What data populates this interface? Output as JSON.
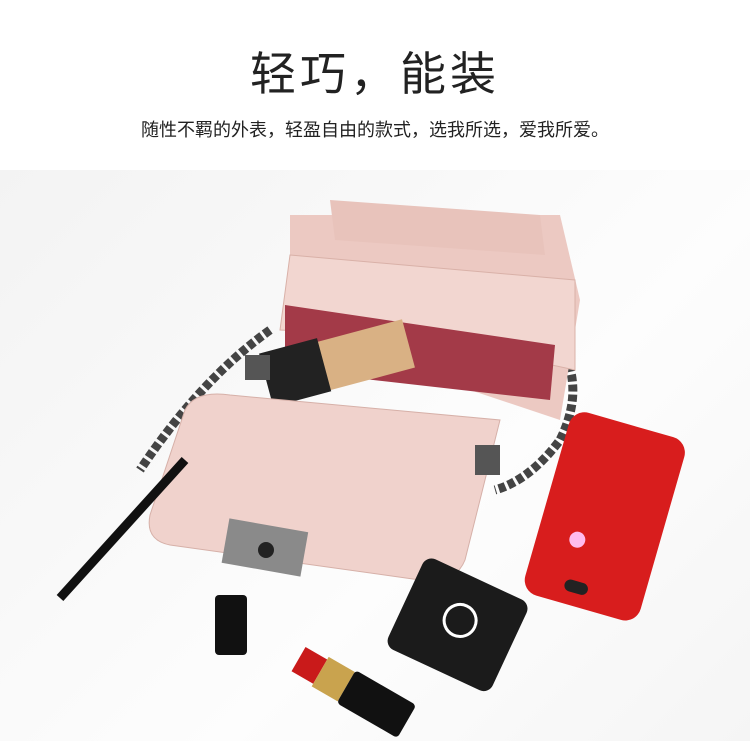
{
  "header": {
    "title": "轻巧，能装",
    "subtitle": "随性不羁的外表，轻盈自由的款式，选我所选，爱我所爱。"
  },
  "colors": {
    "bag": "#f0d2cc",
    "phone": "#d81d1d",
    "background": "#ffffff"
  }
}
